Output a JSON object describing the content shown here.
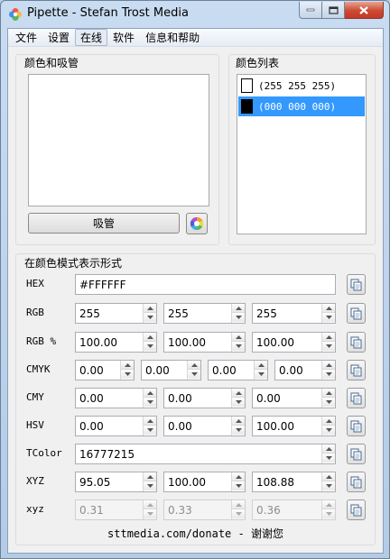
{
  "window": {
    "title": "Pipette - Stefan Trost Media"
  },
  "menu": [
    "文件",
    "设置",
    "在线",
    "软件",
    "信息和帮助"
  ],
  "picker": {
    "title": "颜色和吸管",
    "pipette_button": "吸管"
  },
  "color_list": {
    "title": "颜色列表",
    "items": [
      {
        "label": "(255 255 255)",
        "color": "#ffffff",
        "selected": false
      },
      {
        "label": "(000 000 000)",
        "color": "#000000",
        "selected": true
      }
    ]
  },
  "modes": {
    "title": "在颜色模式表示形式",
    "rows": [
      {
        "label": "HEX",
        "values": [
          "#FFFFFF"
        ]
      },
      {
        "label": "RGB",
        "values": [
          "255",
          "255",
          "255"
        ]
      },
      {
        "label": "RGB %",
        "values": [
          "100.00",
          "100.00",
          "100.00"
        ]
      },
      {
        "label": "CMYK",
        "values": [
          "0.00",
          "0.00",
          "0.00",
          "0.00"
        ]
      },
      {
        "label": "CMY",
        "values": [
          "0.00",
          "0.00",
          "0.00"
        ]
      },
      {
        "label": "HSV",
        "values": [
          "0.00",
          "0.00",
          "100.00"
        ]
      },
      {
        "label": "TColor",
        "values": [
          "16777215"
        ]
      },
      {
        "label": "XYZ",
        "values": [
          "95.05",
          "100.00",
          "108.88"
        ]
      },
      {
        "label": "xyz",
        "values": [
          "0.31",
          "0.33",
          "0.36"
        ]
      }
    ]
  },
  "footer": "sttmedia.com/donate - 谢谢您"
}
